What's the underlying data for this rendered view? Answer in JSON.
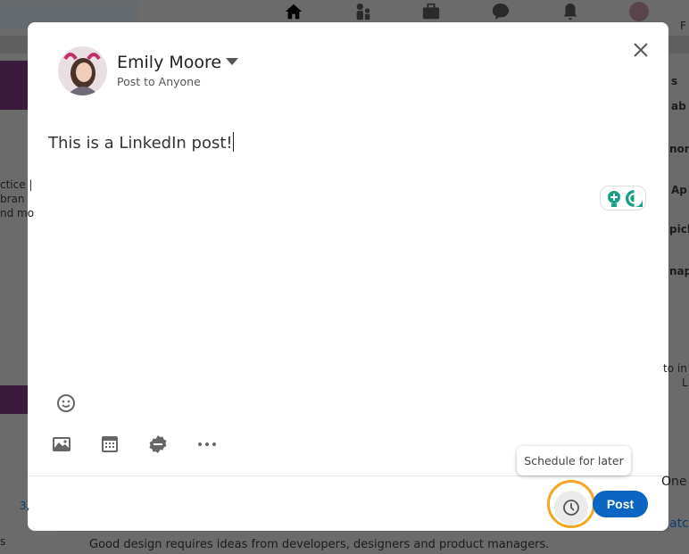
{
  "background": {
    "left_fragments": [
      "ctice |",
      "bran",
      "nd mo",
      "3,",
      "s"
    ],
    "right_fragments": [
      "s",
      "ab",
      "non",
      "Ap",
      "pick",
      "nap",
      "to in",
      "L",
      "One",
      "atch",
      "F"
    ],
    "bottom_text": "Good design requires ideas from developers, designers and product managers."
  },
  "modal": {
    "user_name": "Emily Moore",
    "visibility": "Post to Anyone",
    "post_text": "This is a LinkedIn post!",
    "tooltip": "Schedule for later",
    "post_button": "Post",
    "icons": [
      "emoji-icon",
      "image-icon",
      "event-icon",
      "celebrate-icon",
      "more-icon",
      "clock-icon",
      "close-icon"
    ]
  },
  "colors": {
    "accent": "#0a66c2",
    "highlight": "#f5a623",
    "grammarly": "#15a085"
  }
}
